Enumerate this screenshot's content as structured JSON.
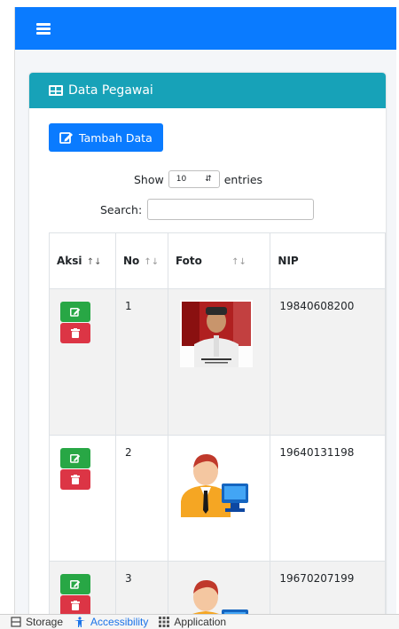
{
  "navbar": {
    "menu_icon": "hamburger-icon",
    "color": "#0a7bff"
  },
  "card": {
    "title": "Data Pegawai",
    "header_color": "#17a2b8",
    "add_button": "Tambah Data"
  },
  "table_controls": {
    "show_label": "Show",
    "entries_value": "10",
    "entries_label": "entries",
    "search_label": "Search:",
    "search_value": ""
  },
  "table": {
    "columns": [
      "Aksi",
      "No",
      "Foto",
      "NIP"
    ],
    "rows": [
      {
        "no": "1",
        "photo": "portrait-photo",
        "nip": "19840608200"
      },
      {
        "no": "2",
        "photo": "user-computer-icon",
        "nip": "19640131198"
      },
      {
        "no": "3",
        "photo": "user-computer-icon",
        "nip": "19670207199"
      }
    ]
  },
  "devtools": {
    "tabs": [
      {
        "label": "Storage",
        "icon": "storage-icon"
      },
      {
        "label": "Accessibility",
        "icon": "accessibility-icon",
        "active": true
      },
      {
        "label": "Application",
        "icon": "application-icon"
      }
    ]
  }
}
